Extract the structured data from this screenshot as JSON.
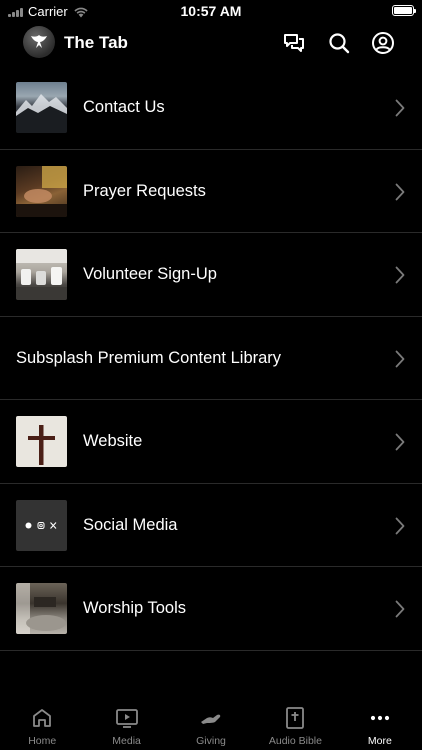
{
  "status": {
    "carrier": "Carrier",
    "time": "10:57 AM"
  },
  "header": {
    "title": "The Tab"
  },
  "items": [
    {
      "label": "Contact Us",
      "thumb": "mountains"
    },
    {
      "label": "Prayer Requests",
      "thumb": "hands"
    },
    {
      "label": "Volunteer Sign-Up",
      "thumb": "coffee"
    },
    {
      "label": "Subsplash Premium Content Library",
      "thumb": ""
    },
    {
      "label": "Website",
      "thumb": "cross"
    },
    {
      "label": "Social Media",
      "thumb": "social"
    },
    {
      "label": "Worship Tools",
      "thumb": "stage"
    }
  ],
  "tabs": [
    {
      "label": "Home",
      "icon": "home-icon"
    },
    {
      "label": "Media",
      "icon": "media-icon"
    },
    {
      "label": "Giving",
      "icon": "giving-icon"
    },
    {
      "label": "Audio Bible",
      "icon": "bible-icon"
    },
    {
      "label": "More",
      "icon": "more-icon"
    }
  ]
}
